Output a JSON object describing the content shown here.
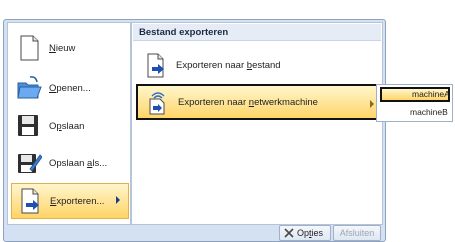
{
  "menu": {
    "items": [
      {
        "id": "new",
        "label_html": "Nieuw",
        "underline_index": 0,
        "icon": "new-document-icon"
      },
      {
        "id": "open",
        "label_html": "Openen...",
        "underline_index": 0,
        "icon": "open-folder-icon"
      },
      {
        "id": "save",
        "label_html": "Opslaan",
        "underline_index": 1,
        "icon": "save-disk-icon"
      },
      {
        "id": "saveas",
        "label_html": "Opslaan als...",
        "underline_index": 8,
        "icon": "save-as-icon"
      },
      {
        "id": "export",
        "label_html": "Exporteren...",
        "underline_index": 0,
        "icon": "export-document-icon"
      }
    ]
  },
  "panel": {
    "header": "Bestand exporteren",
    "items": [
      {
        "id": "export-file",
        "label": "Exporteren naar bestand",
        "icon": "export-to-file-icon"
      },
      {
        "id": "export-network",
        "label": "Exporteren naar netwerkmachine",
        "icon": "network-export-icon"
      }
    ]
  },
  "flyout": {
    "items": [
      "machineA",
      "machineB"
    ]
  },
  "buttons": {
    "options": "Opties",
    "close": "Afsluiten"
  },
  "colors": {
    "highlight_top": "#fff6cc",
    "highlight_bottom": "#ffd467",
    "frame": "#d4e1f2",
    "arrow": "#1f3f7a"
  }
}
